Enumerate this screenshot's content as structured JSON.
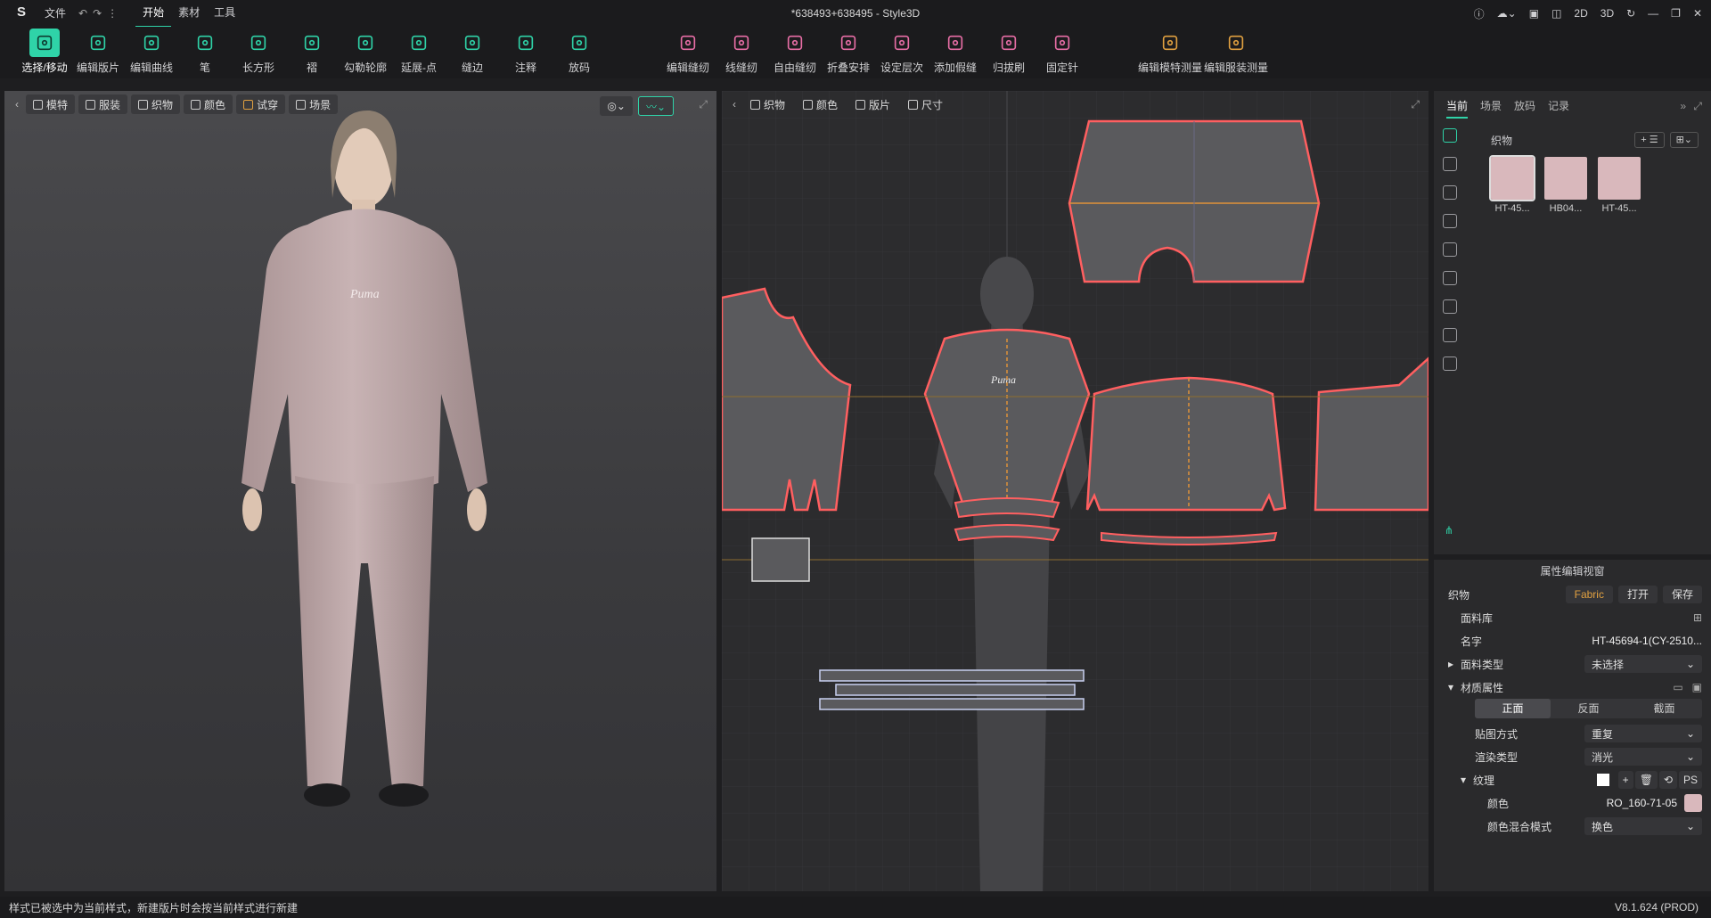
{
  "app": {
    "title": "*638493+638495 - Style3D",
    "version": "V8.1.624 (PROD)"
  },
  "menu": {
    "file": "文件",
    "tabs": [
      "开始",
      "素材",
      "工具"
    ]
  },
  "toolbar": {
    "tools": [
      {
        "label": "选择/移动",
        "icon": "select-move-icon"
      },
      {
        "label": "编辑版片",
        "icon": "edit-pattern-icon"
      },
      {
        "label": "编辑曲线",
        "icon": "edit-curve-icon"
      },
      {
        "label": "笔",
        "icon": "pen-icon"
      },
      {
        "label": "长方形",
        "icon": "rectangle-icon"
      },
      {
        "label": "褶",
        "icon": "pleat-icon"
      },
      {
        "label": "勾勒轮廓",
        "icon": "trace-outline-icon"
      },
      {
        "label": "延展-点",
        "icon": "extend-point-icon"
      },
      {
        "label": "缝边",
        "icon": "seam-allowance-icon"
      },
      {
        "label": "注释",
        "icon": "annotation-icon"
      },
      {
        "label": "放码",
        "icon": "grading-icon"
      }
    ],
    "tools2": [
      {
        "label": "编辑缝纫",
        "icon": "edit-sewing-icon"
      },
      {
        "label": "线缝纫",
        "icon": "line-sewing-icon"
      },
      {
        "label": "自由缝纫",
        "icon": "free-sewing-icon"
      },
      {
        "label": "折叠安排",
        "icon": "fold-arrange-icon"
      },
      {
        "label": "设定层次",
        "icon": "set-layer-icon"
      },
      {
        "label": "添加假缝",
        "icon": "add-tack-icon"
      },
      {
        "label": "归拔刷",
        "icon": "shrink-brush-icon"
      },
      {
        "label": "固定针",
        "icon": "pin-icon"
      }
    ],
    "tools3": [
      {
        "label": "编辑模特测量",
        "icon": "avatar-measure-icon"
      },
      {
        "label": "编辑服装测量",
        "icon": "garment-measure-icon"
      }
    ]
  },
  "win": {
    "v2d": "2D",
    "v3d": "3D"
  },
  "view3d": {
    "buttons": [
      "模特",
      "服装",
      "织物",
      "颜色",
      "试穿",
      "场景"
    ],
    "logo_text": "Puma"
  },
  "view2d": {
    "buttons": [
      "织物",
      "颜色",
      "版片",
      "尺寸"
    ],
    "logo_text": "Puma"
  },
  "right": {
    "tabs": [
      "当前",
      "场景",
      "放码",
      "记录"
    ],
    "fabric_header": "织物",
    "swatches": [
      {
        "caption": "HT-45..."
      },
      {
        "caption": "HB04..."
      },
      {
        "caption": "HT-45..."
      }
    ]
  },
  "props": {
    "title": "属性编辑视窗",
    "fabric_label": "织物",
    "fabric_btn": "Fabric",
    "open_btn": "打开",
    "save_btn": "保存",
    "library": "面料库",
    "name_label": "名字",
    "name_value": "HT-45694-1(CY-2510...",
    "type_label": "面料类型",
    "type_value": "未选择",
    "material_label": "材质属性",
    "faces": [
      "正面",
      "反面",
      "截面"
    ],
    "mapping_label": "贴图方式",
    "mapping_value": "重复",
    "render_label": "渲染类型",
    "render_value": "消光",
    "texture_label": "纹理",
    "texture_btns": [
      "+",
      "🗑",
      "⟲",
      "PS"
    ],
    "color_label": "颜色",
    "color_value": "RO_160-71-05",
    "color_swatch": "#d9b8bc",
    "blend_label": "颜色混合模式",
    "blend_value": "换色"
  },
  "status": {
    "message": "样式已被选中为当前样式，新建版片时会按当前样式进行新建"
  },
  "colors": {
    "accent": "#2fd3a8",
    "pattern_line": "#ff5f60",
    "fabric": "#d9b8bc"
  }
}
